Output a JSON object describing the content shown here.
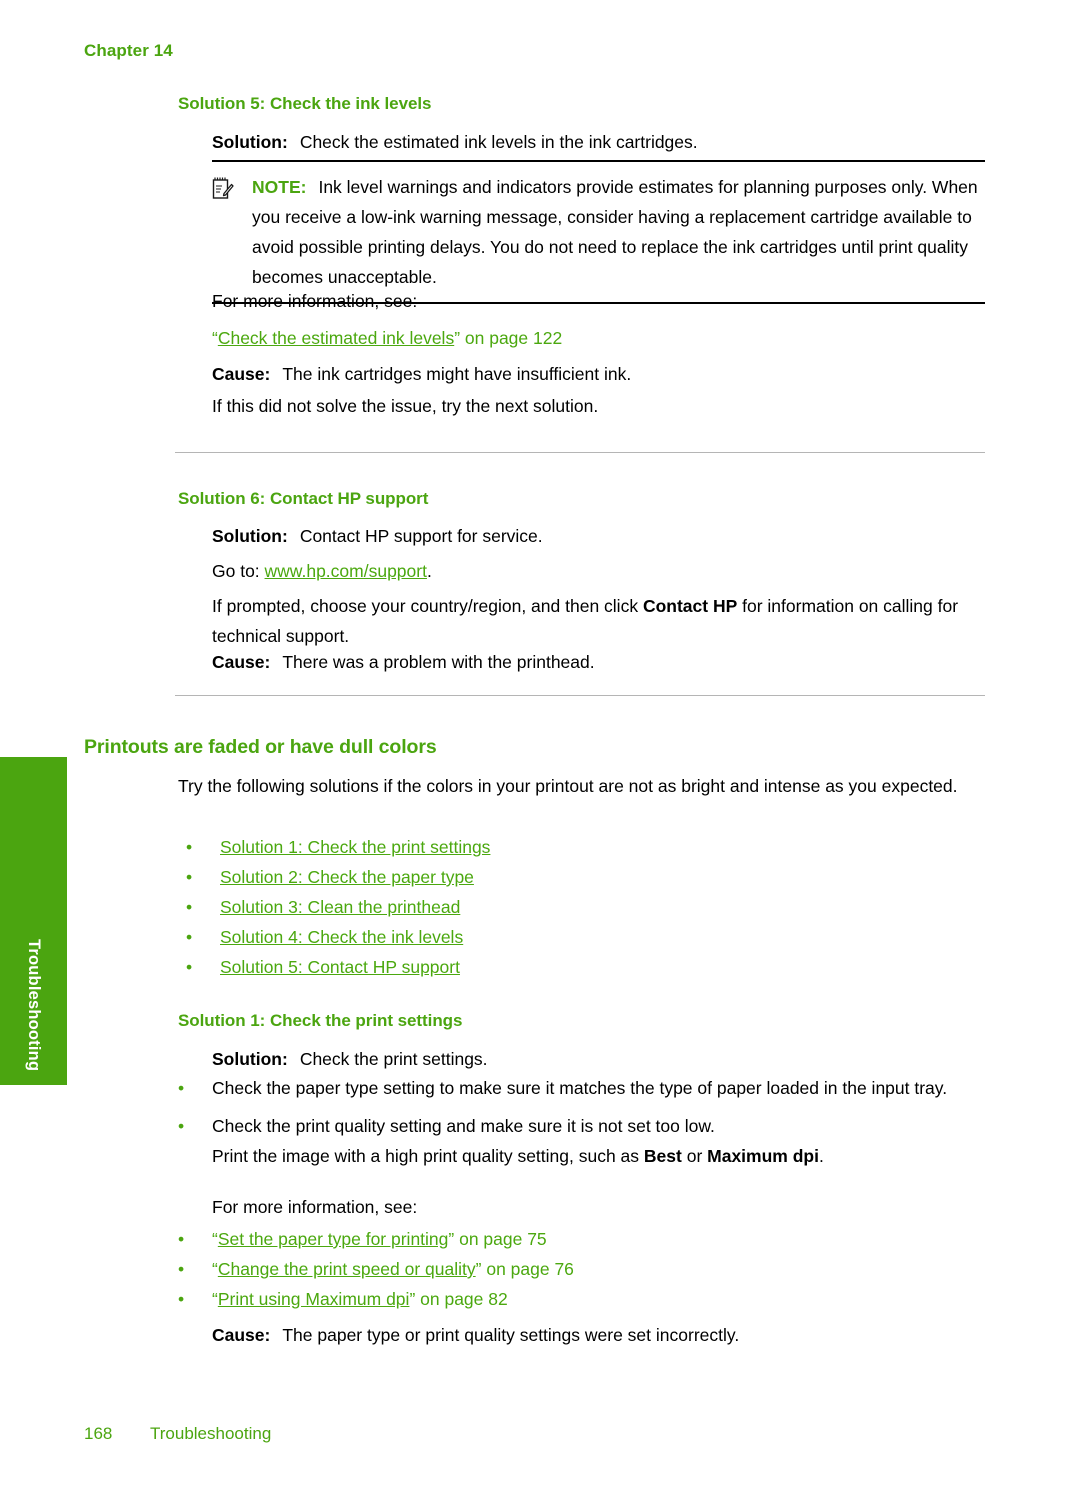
{
  "header": {
    "chapter": "Chapter 14"
  },
  "side_tab": {
    "label": "Troubleshooting"
  },
  "footer": {
    "page_number": "168",
    "section": "Troubleshooting"
  },
  "colors": {
    "heading_green": "#4ba510",
    "link_green": "#4ba80f",
    "tab_green": "#4ba510",
    "rule_gray": "#b5b5b5",
    "text_black": "#000000"
  },
  "solution5": {
    "heading": "Solution 5: Check the ink levels",
    "solution_label": "Solution:",
    "solution_text": "Check the estimated ink levels in the ink cartridges.",
    "note": {
      "icon": "note-pad-pencil-icon",
      "label": "NOTE:",
      "text": "Ink level warnings and indicators provide estimates for planning purposes only. When you receive a low-ink warning message, consider having a replacement cartridge available to avoid possible printing delays. You do not need to replace the ink cartridges until print quality becomes unacceptable."
    },
    "more_info_label": "For more information, see:",
    "cross_reference": {
      "open_quote": "“",
      "link_text": "Check the estimated ink levels",
      "close_quote": "”",
      "suffix": " on page 122"
    },
    "cause_label": "Cause:",
    "cause_text": "The ink cartridges might have insufficient ink.",
    "next_solution_text": "If this did not solve the issue, try the next solution."
  },
  "solution6": {
    "heading": "Solution 6: Contact HP support",
    "solution_label": "Solution:",
    "solution_text": "Contact HP support for service.",
    "goto_prefix": "Go to: ",
    "goto_link": "www.hp.com/support",
    "goto_suffix": ".",
    "prompt_text_1": "If prompted, choose your country/region, and then click ",
    "prompt_bold": "Contact HP",
    "prompt_text_2": " for information on calling for technical support.",
    "cause_label": "Cause:",
    "cause_text": "There was a problem with the printhead."
  },
  "faded_section": {
    "heading": "Printouts are faded or have dull colors",
    "intro": "Try the following solutions if the colors in your printout are not as bright and intense as you expected.",
    "solution_links": [
      "Solution 1: Check the print settings",
      "Solution 2: Check the paper type",
      "Solution 3: Clean the printhead",
      "Solution 4: Check the ink levels",
      "Solution 5: Contact HP support"
    ]
  },
  "solution1": {
    "heading": "Solution 1: Check the print settings",
    "solution_label": "Solution:",
    "solution_text": "Check the print settings.",
    "bullets": [
      "Check the paper type setting to make sure it matches the type of paper loaded in the input tray."
    ],
    "bullet2_line1": "Check the print quality setting and make sure it is not set too low.",
    "bullet2_line2_pre": "Print the image with a high print quality setting, such as ",
    "bullet2_bold_1": "Best",
    "bullet2_line2_mid": " or ",
    "bullet2_bold_2": "Maximum dpi",
    "bullet2_line2_post": ".",
    "more_info_label": "For more information, see:",
    "references": [
      {
        "open_quote": "“",
        "link_text": "Set the paper type for printing",
        "close_quote": "”",
        "suffix": " on page 75"
      },
      {
        "open_quote": "“",
        "link_text": "Change the print speed or quality",
        "close_quote": "”",
        "suffix": " on page 76"
      },
      {
        "open_quote": "“",
        "link_text": "Print using Maximum dpi",
        "close_quote": "”",
        "suffix": " on page 82"
      }
    ],
    "cause_label": "Cause:",
    "cause_text": "The paper type or print quality settings were set incorrectly."
  }
}
